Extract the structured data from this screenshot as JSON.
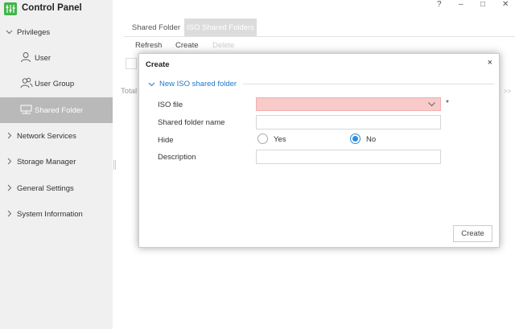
{
  "app": {
    "title": "Control Panel",
    "logo_icon": "control-panel-icon",
    "brand_color": "#41b649"
  },
  "window_controls": {
    "help": "?",
    "minimize": "–",
    "maximize": "□",
    "close": "✕"
  },
  "sidebar": {
    "items": [
      {
        "label": "Privileges",
        "expanded": true
      },
      {
        "label": "User",
        "icon": "user-icon"
      },
      {
        "label": "User Group",
        "icon": "user-group-icon"
      },
      {
        "label": "Shared Folder",
        "icon": "shared-folder-icon",
        "selected": true
      },
      {
        "label": "Network Services"
      },
      {
        "label": "Storage Manager"
      },
      {
        "label": "General Settings"
      },
      {
        "label": "System Information"
      }
    ]
  },
  "tabs": [
    {
      "label": "Shared Folder"
    },
    {
      "label": "ISO Shared Folders",
      "active": true
    }
  ],
  "toolbar": {
    "refresh": "Refresh",
    "create": "Create",
    "delete": "Delete"
  },
  "background": {
    "total": "Total",
    "pager": ">>"
  },
  "dialog": {
    "title": "Create",
    "close": "×",
    "section": "New ISO shared folder",
    "fields": {
      "iso_file": {
        "label": "ISO file",
        "value": "",
        "required_mark": "*"
      },
      "shared_folder_name": {
        "label": "Shared folder name",
        "value": ""
      },
      "hide": {
        "label": "Hide",
        "options": [
          "Yes",
          "No"
        ],
        "selected": "No"
      },
      "description": {
        "label": "Description",
        "value": ""
      }
    },
    "submit": "Create"
  },
  "colors": {
    "accent": "#2b8ce0",
    "section_text": "#1f78c8",
    "error_field": "#f8caca",
    "sidebar_selected": "#b9b9b9"
  }
}
